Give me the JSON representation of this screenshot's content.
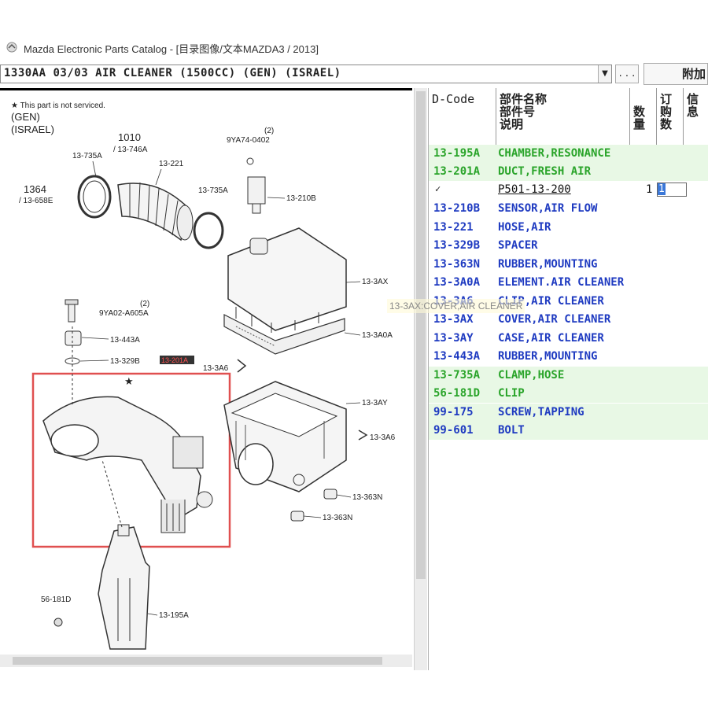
{
  "window": {
    "title": "Mazda Electronic Parts Catalog - [目录图像/文本MAZDA3 / 2013]"
  },
  "toolbar": {
    "model_select_value": "1330AA 03/03 AIR CLEANER (1500CC) (GEN) (ISRAEL)",
    "dots_label": ". . .",
    "add_label": "附加"
  },
  "diagram": {
    "note": "★ This part is not serviced.",
    "gen": "(GEN)",
    "israel": "(ISRAEL)",
    "labels": {
      "ref_1010": "1010",
      "ref_13_746a": "/ 13-746A",
      "ref_1364": "1364",
      "ref_13_658e": "/ 13-658E",
      "l_13_735a_top": "13-735A",
      "l_13_221": "13-221",
      "l_13_735a_mid": "13-735A",
      "l_9ya74": "9YA74-0402",
      "l_9ya74_q": "(2)",
      "l_13_210b": "13-210B",
      "l_13_3ax": "13-3AX",
      "l_9ya02": "9YA02-A605A",
      "l_9ya02_q": "(2)",
      "l_13_443a": "13-443A",
      "l_13_329b": "13-329B",
      "l_13_201a": "13-201A",
      "l_13_3a0a": "13-3A0A",
      "l_13_3a6_a": "13-3A6",
      "l_13_3ay": "13-3AY",
      "l_13_3a6_b": "13-3A6",
      "l_13_363n_a": "13-363N",
      "l_13_363n_b": "13-363N",
      "l_56_181d": "56-181D",
      "l_13_195a": "13-195A"
    },
    "tooltip": "13-3AX:COVER,AIR CLEANER"
  },
  "table": {
    "headers": {
      "dcode": "D-Code",
      "name": "部件名称",
      "partno": "部件号",
      "desc": "说明",
      "qty": "数量",
      "order_qty": "订购数",
      "info": "信息"
    },
    "rows": [
      {
        "code": "13-195A",
        "name": "CHAMBER,RESONANCE",
        "color": "green"
      },
      {
        "code": "13-201A",
        "name": "DUCT,FRESH AIR",
        "color": "green"
      },
      {
        "code": "",
        "name": "",
        "color": "sub",
        "part_no": "P501-13-200",
        "qty": "1",
        "order": "1",
        "checked": "✓"
      },
      {
        "code": "13-210B",
        "name": "SENSOR,AIR FLOW",
        "color": "blue"
      },
      {
        "code": "13-221",
        "name": "HOSE,AIR",
        "color": "blue"
      },
      {
        "code": "13-329B",
        "name": "SPACER",
        "color": "blue"
      },
      {
        "code": "13-363N",
        "name": "RUBBER,MOUNTING",
        "color": "blue"
      },
      {
        "code": "13-3A0A",
        "name": "ELEMENT.AIR CLEANER",
        "color": "blue"
      },
      {
        "code": "13-3A6",
        "name": "CLIP,AIR CLEANER",
        "color": "blue"
      },
      {
        "code": "13-3AX",
        "name": "COVER,AIR CLEANER",
        "color": "blue"
      },
      {
        "code": "13-3AY",
        "name": "CASE,AIR CLEANER",
        "color": "blue"
      },
      {
        "code": "13-443A",
        "name": "RUBBER,MOUNTING",
        "color": "blue"
      },
      {
        "code": "13-735A",
        "name": "CLAMP,HOSE",
        "color": "green"
      },
      {
        "code": "56-181D",
        "name": "CLIP",
        "color": "green"
      },
      {
        "code": "99-175",
        "name": "SCREW,TAPPING",
        "color": "blue"
      },
      {
        "code": "99-601",
        "name": "BOLT",
        "color": "blue"
      }
    ]
  },
  "colors": {
    "blue_text": "#1f3bc1",
    "green_text": "#2aa42a",
    "row_green_bg": "#e8f8e5",
    "highlight_box": "#e05050"
  }
}
